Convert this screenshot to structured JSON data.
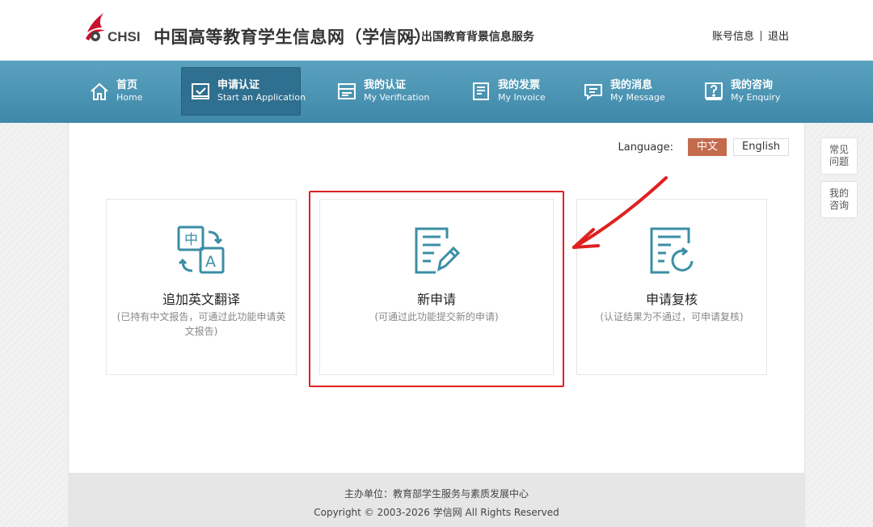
{
  "header": {
    "logo_text": "CHSI",
    "site_title": "中国高等教育学生信息网（学信网）",
    "site_subtitle": "— 出国教育背景信息服务",
    "account_label": "账号信息",
    "logout_label": "退出"
  },
  "nav": {
    "items": [
      {
        "zh": "首页",
        "en": "Home",
        "icon": "home-icon"
      },
      {
        "zh": "申请认证",
        "en": "Start an Application",
        "icon": "application-icon",
        "active": true
      },
      {
        "zh": "我的认证",
        "en": "My Verification",
        "icon": "verification-icon"
      },
      {
        "zh": "我的发票",
        "en": "My Invoice",
        "icon": "invoice-icon"
      },
      {
        "zh": "我的消息",
        "en": "My Message",
        "icon": "message-icon"
      },
      {
        "zh": "我的咨询",
        "en": "My Enquiry",
        "icon": "enquiry-icon"
      }
    ]
  },
  "language": {
    "label": "Language:",
    "options": [
      "中文",
      "English"
    ],
    "selected": "中文"
  },
  "cards": [
    {
      "title": "追加英文翻译",
      "desc": "(已持有中文报告，可通过此功能申请英文报告)",
      "icon": "translate-icon"
    },
    {
      "title": "新申请",
      "desc": "(可通过此功能提交新的申请)",
      "icon": "new-application-icon"
    },
    {
      "title": "申请复核",
      "desc": "(认证结果为不通过，可申请复核)",
      "icon": "review-icon"
    }
  ],
  "side": {
    "faq": "常见\n问题",
    "enquiry": "我的\n咨询"
  },
  "footer": {
    "sponsor": "主办单位：教育部学生服务与素质发展中心",
    "copyright": "Copyright © 2003-2026 学信网 All Rights Reserved"
  },
  "colors": {
    "nav_bg": "#4a93b3",
    "nav_active": "#2f6f8f",
    "icon_teal": "#3b8ea5",
    "lang_active": "#c46b4e",
    "highlight_red": "#e02020"
  }
}
